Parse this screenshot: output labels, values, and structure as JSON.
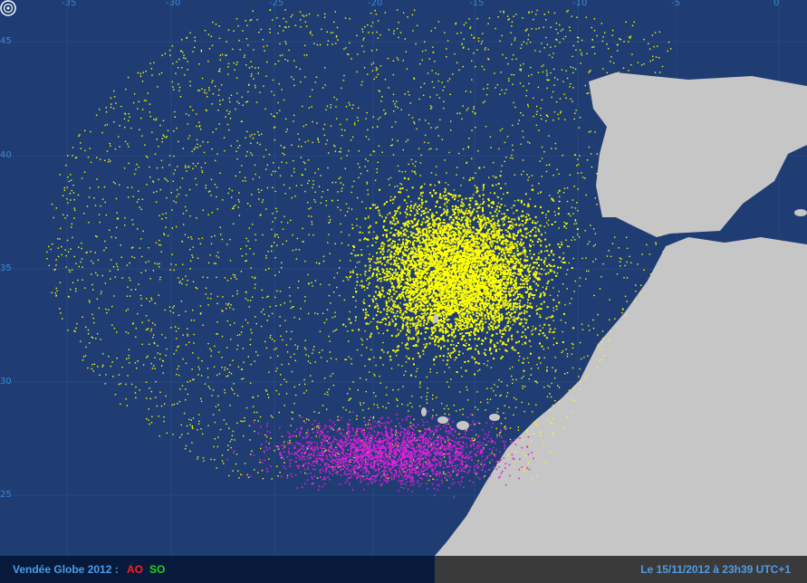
{
  "map": {
    "longitude_ticks": [
      "-35",
      "-30",
      "-25",
      "-20",
      "-15",
      "-10",
      "-5",
      "0"
    ],
    "latitude_ticks": [
      "45",
      "40",
      "35",
      "30",
      "25"
    ],
    "colors": {
      "ocean": "#1f3d72",
      "land": "#c6c6c6",
      "fleet_ao": "#ffff00",
      "fleet_so": "#e01ee0",
      "grid": "#2b4f8a",
      "tick_label": "#3b86d6"
    },
    "marker_icon": "target-circle-icon"
  },
  "footer": {
    "race_title": "Vendée Globe 2012 :",
    "ao_label": "AO",
    "so_label": "SO",
    "timestamp": "Le 15/11/2012 à 23h39 UTC+1",
    "colors": {
      "ao": "#ff1e1e",
      "so": "#1fd41f",
      "title": "#4f9be6"
    }
  }
}
